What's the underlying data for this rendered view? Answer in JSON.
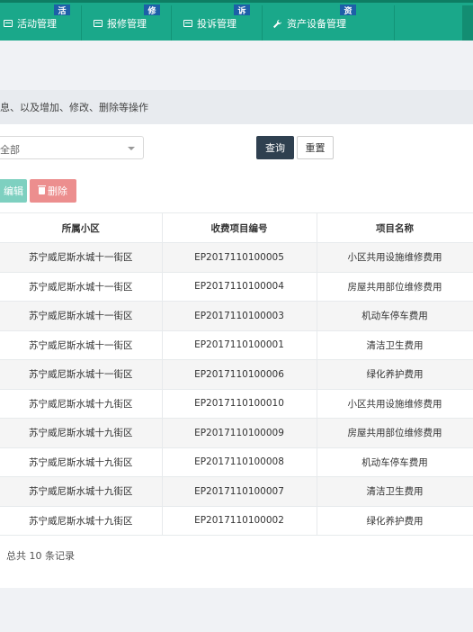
{
  "nav": {
    "items": [
      {
        "label": "活动管理",
        "badge": "活"
      },
      {
        "label": "报修管理",
        "badge": "修"
      },
      {
        "label": "投诉管理",
        "badge": "诉"
      },
      {
        "label": "资产设备管理",
        "badge": "资"
      }
    ],
    "bg_color": "#1aa88a",
    "badge_color": "#1d5fa8"
  },
  "description": "息、以及增加、修改、删除等操作",
  "filter": {
    "select_value": "全部",
    "query_label": "查询",
    "reset_label": "重置"
  },
  "toolbar": {
    "edit_label": "编辑",
    "delete_label": "删除"
  },
  "table": {
    "headers": [
      "所属小区",
      "收费项目编号",
      "项目名称"
    ],
    "rows": [
      [
        "苏宁威尼斯水城十一街区",
        "EP2017110100005",
        "小区共用设施维修费用"
      ],
      [
        "苏宁威尼斯水城十一街区",
        "EP2017110100004",
        "房屋共用部位维修费用"
      ],
      [
        "苏宁威尼斯水城十一街区",
        "EP2017110100003",
        "机动车停车费用"
      ],
      [
        "苏宁威尼斯水城十一街区",
        "EP2017110100001",
        "清洁卫生费用"
      ],
      [
        "苏宁威尼斯水城十一街区",
        "EP2017110100006",
        "绿化养护费用"
      ],
      [
        "苏宁威尼斯水城十九街区",
        "EP2017110100010",
        "小区共用设施维修费用"
      ],
      [
        "苏宁威尼斯水城十九街区",
        "EP2017110100009",
        "房屋共用部位维修费用"
      ],
      [
        "苏宁威尼斯水城十九街区",
        "EP2017110100008",
        "机动车停车费用"
      ],
      [
        "苏宁威尼斯水城十九街区",
        "EP2017110100007",
        "清洁卫生费用"
      ],
      [
        "苏宁威尼斯水城十九街区",
        "EP2017110100002",
        "绿化养护费用"
      ]
    ]
  },
  "footer": {
    "total_text": "总共 10 条记录"
  }
}
